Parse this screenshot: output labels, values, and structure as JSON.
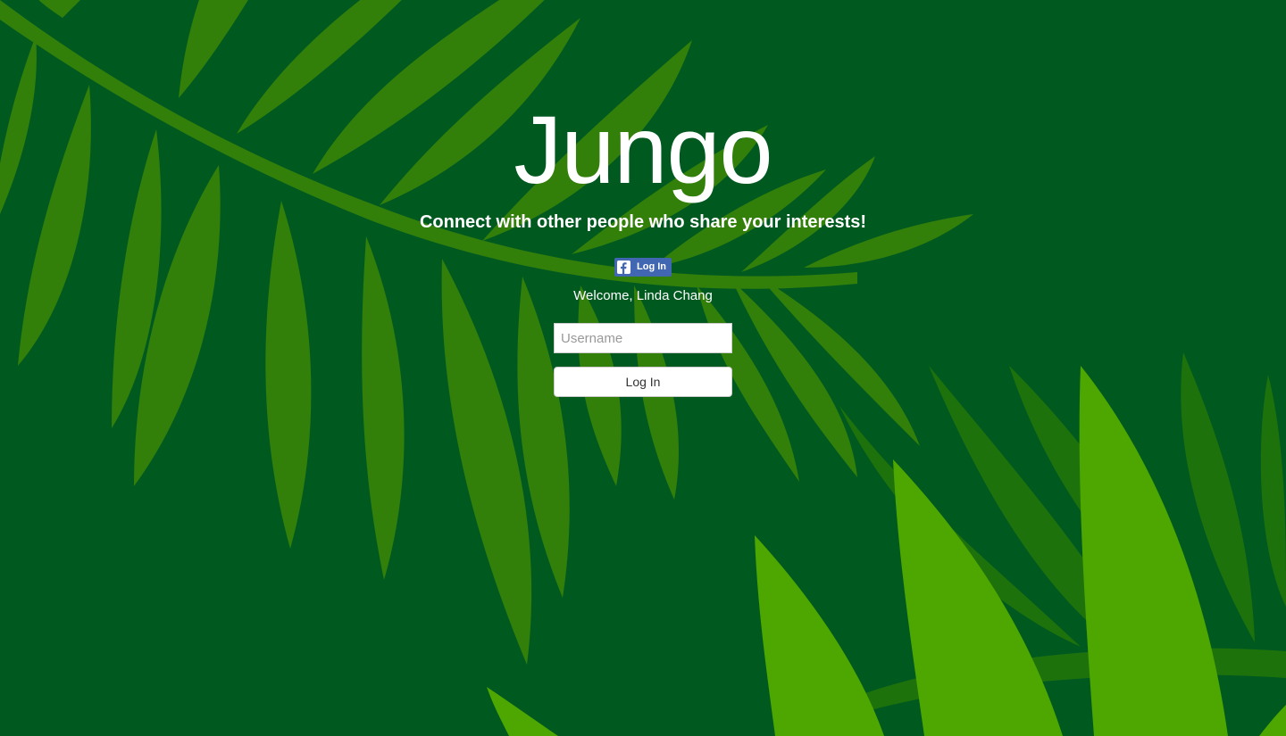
{
  "app": {
    "title": "Jungo",
    "tagline": "Connect with other people who share your interests!"
  },
  "facebook_login": {
    "label": "Log In",
    "icon": "facebook-f-icon"
  },
  "welcome_text": "Welcome, Linda Chang",
  "login_form": {
    "username_placeholder": "Username",
    "username_value": "",
    "submit_label": "Log In"
  },
  "colors": {
    "background": "#005a20",
    "leaf_mid": "#327f0a",
    "leaf_dark": "#1e720c",
    "leaf_light": "#4ea600",
    "facebook_blue": "#4267b2",
    "text": "#ffffff"
  }
}
